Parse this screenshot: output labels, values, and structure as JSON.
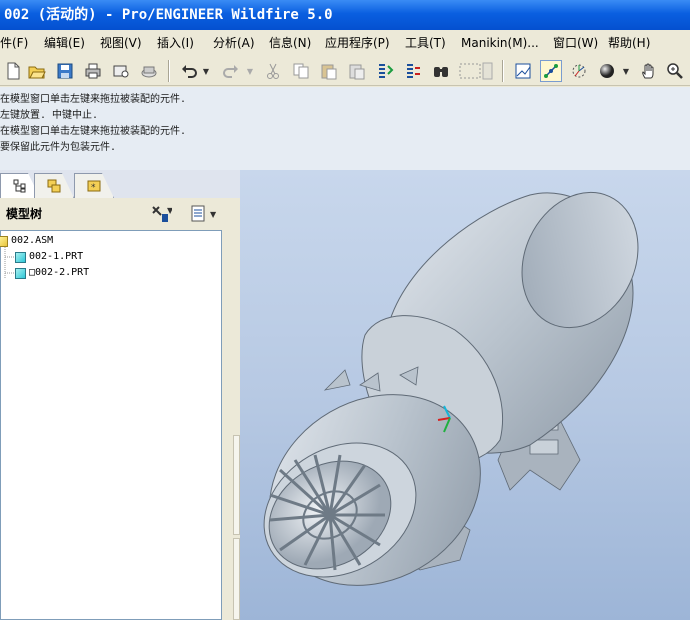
{
  "window": {
    "title": "002 (活动的) - Pro/ENGINEER Wildfire 5.0"
  },
  "menu": [
    {
      "label": "件(F)"
    },
    {
      "label": "编辑(E)"
    },
    {
      "label": "视图(V)"
    },
    {
      "label": "插入(I)"
    },
    {
      "label": "分析(A)"
    },
    {
      "label": "信息(N)"
    },
    {
      "label": "应用程序(P)"
    },
    {
      "label": "工具(T)"
    },
    {
      "label": "Manikin(M)..."
    },
    {
      "label": "窗口(W)"
    },
    {
      "label": "帮助(H)"
    }
  ],
  "toolbar": {
    "icons": [
      "new-file-icon",
      "open-folder-icon",
      "save-icon",
      "print-icon",
      "send-mail-icon",
      "disk-icon",
      "undo-icon",
      "redo-icon",
      "cut-icon",
      "copy-icon",
      "paste-icon",
      "paste-special-icon",
      "regenerate-icon",
      "regenerate-manager-icon",
      "find-icon",
      "selection-box-icon",
      "graph-icon",
      "datum-display-icon",
      "spin-center-icon",
      "shading-sphere-icon",
      "pan-hand-icon",
      "zoom-icon"
    ]
  },
  "messages": [
    "在模型窗口单击左键来拖拉被装配的元件.",
    "左键放置. 中键中止.",
    "在模型窗口单击左键来拖拉被装配的元件.",
    "要保留此元件为包装元件."
  ],
  "navigator": {
    "tree_title": "模型树",
    "items": [
      {
        "label": "002.ASM",
        "type": "assembly"
      },
      {
        "label": "002-1.PRT",
        "type": "part"
      },
      {
        "label": "□002-2.PRT",
        "type": "part"
      }
    ]
  },
  "colors": {
    "title_bar": "#0a5fe0",
    "viewport_top": "#c8d7ec",
    "viewport_bottom": "#9db5d7",
    "model": "#b8c2cc"
  }
}
